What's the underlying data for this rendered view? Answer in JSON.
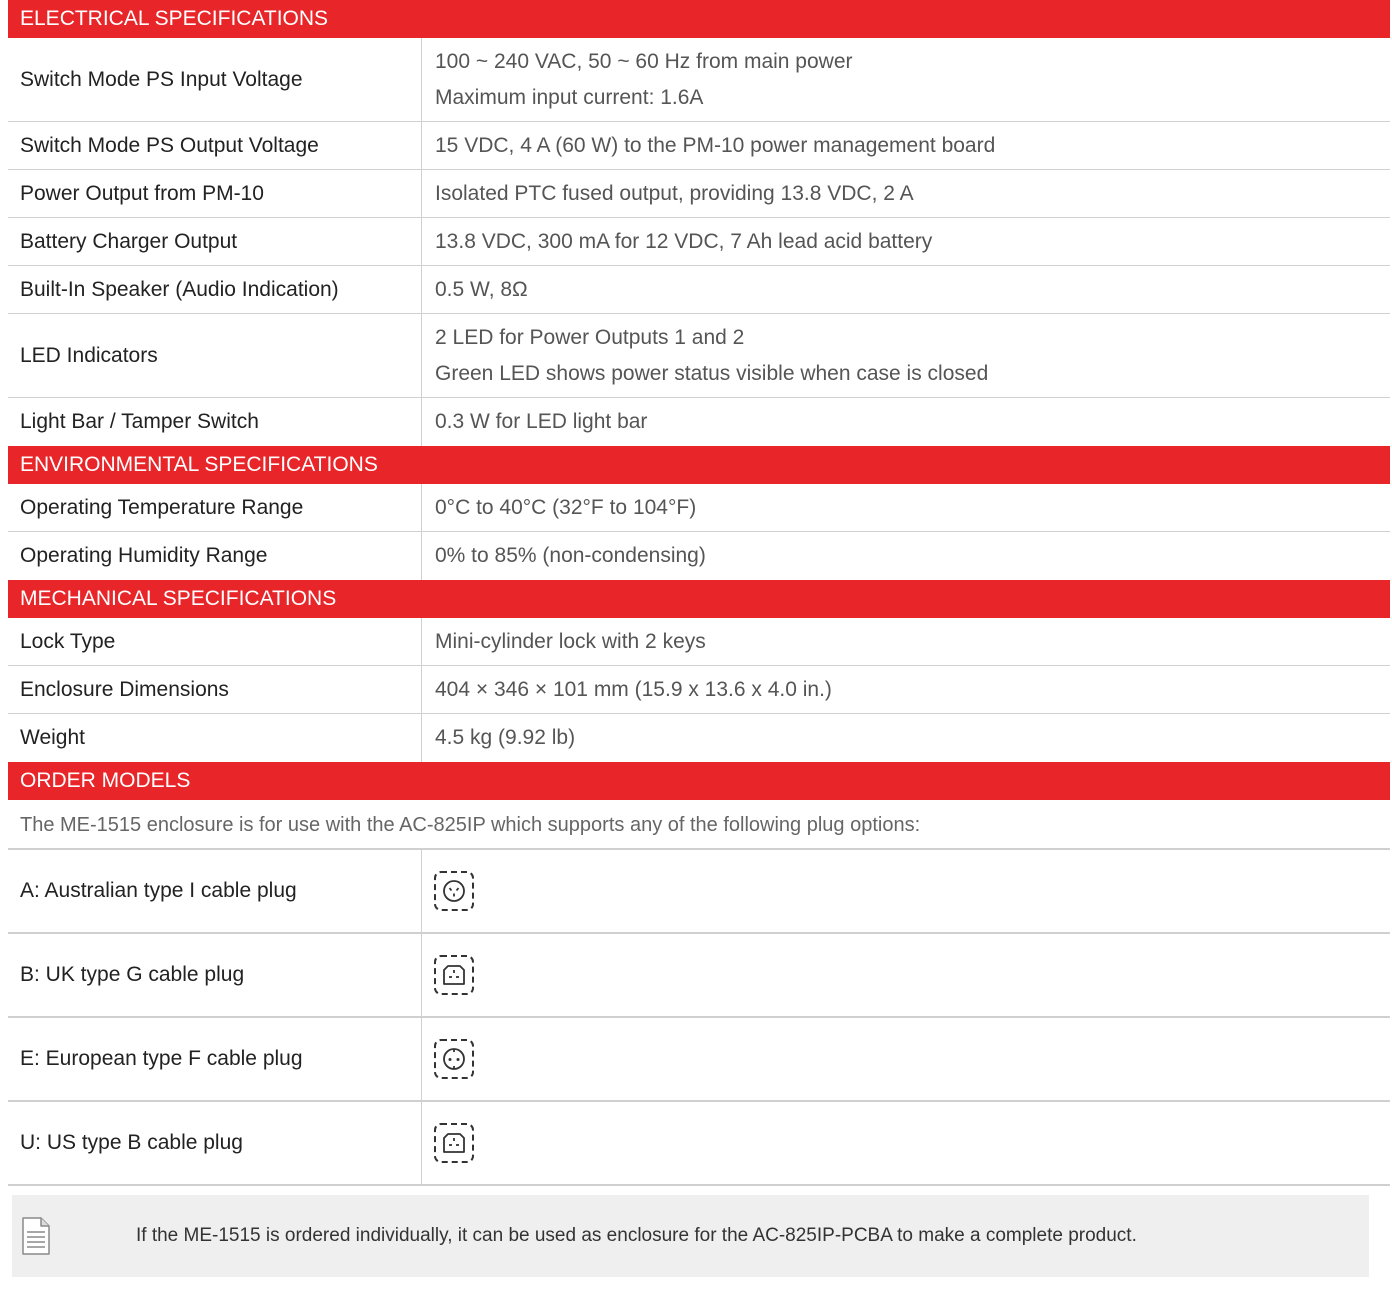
{
  "electrical": {
    "header": "ELECTRICAL SPECIFICATIONS",
    "rows": [
      {
        "label": "Switch Mode PS Input Voltage",
        "values": [
          "100 ~ 240 VAC, 50 ~ 60 Hz from main power",
          "Maximum input current: 1.6A"
        ]
      },
      {
        "label": "Switch Mode PS Output Voltage",
        "values": [
          "15 VDC, 4 A (60 W) to the PM-10 power management board"
        ]
      },
      {
        "label": "Power Output from PM-10",
        "values": [
          "Isolated PTC fused output, providing 13.8 VDC, 2 A"
        ]
      },
      {
        "label": "Battery Charger Output",
        "values": [
          "13.8 VDC, 300 mA for 12 VDC, 7 Ah lead acid battery"
        ]
      },
      {
        "label": "Built-In Speaker (Audio Indication)",
        "values": [
          "0.5 W, 8Ω"
        ]
      },
      {
        "label": "LED Indicators",
        "values": [
          "2 LED for Power Outputs 1 and 2",
          "Green LED shows power status visible when case is closed"
        ]
      },
      {
        "label": "Light Bar / Tamper Switch",
        "values": [
          "0.3 W for LED light bar"
        ]
      }
    ]
  },
  "environmental": {
    "header": "ENVIRONMENTAL SPECIFICATIONS",
    "rows": [
      {
        "label": "Operating Temperature Range",
        "values": [
          "0°C to 40°C (32°F to 104°F)"
        ]
      },
      {
        "label": "Operating Humidity Range",
        "values": [
          "0% to 85% (non-condensing)"
        ]
      }
    ]
  },
  "mechanical": {
    "header": "MECHANICAL SPECIFICATIONS",
    "rows": [
      {
        "label": "Lock Type",
        "values": [
          "Mini-cylinder lock with 2 keys"
        ]
      },
      {
        "label": "Enclosure Dimensions",
        "values": [
          "404 × 346 × 101 mm (15.9 x 13.6 x 4.0 in.)"
        ]
      },
      {
        "label": "Weight",
        "values": [
          "4.5 kg (9.92 lb)"
        ]
      }
    ]
  },
  "order": {
    "header": "ORDER MODELS",
    "intro": "The ME-1515 enclosure is for use with the AC-825IP which supports any of the following plug options:",
    "plugs": [
      {
        "label": "A: Australian type I cable plug",
        "icon": "australian-plug-icon"
      },
      {
        "label": "B: UK type G cable plug",
        "icon": "uk-plug-icon"
      },
      {
        "label": "E: European type F cable plug",
        "icon": "european-plug-icon"
      },
      {
        "label": "U: US type B cable plug",
        "icon": "us-plug-icon"
      }
    ]
  },
  "note": {
    "icon": "document-note-icon",
    "text": "If the ME-1515 is ordered individually, it can be used as enclosure for the AC-825IP-PCBA to make a complete product."
  },
  "colors": {
    "header_bg": "#e8262a",
    "header_text": "#ffffff",
    "note_bg": "#efefef",
    "border": "#d0d0d0"
  }
}
